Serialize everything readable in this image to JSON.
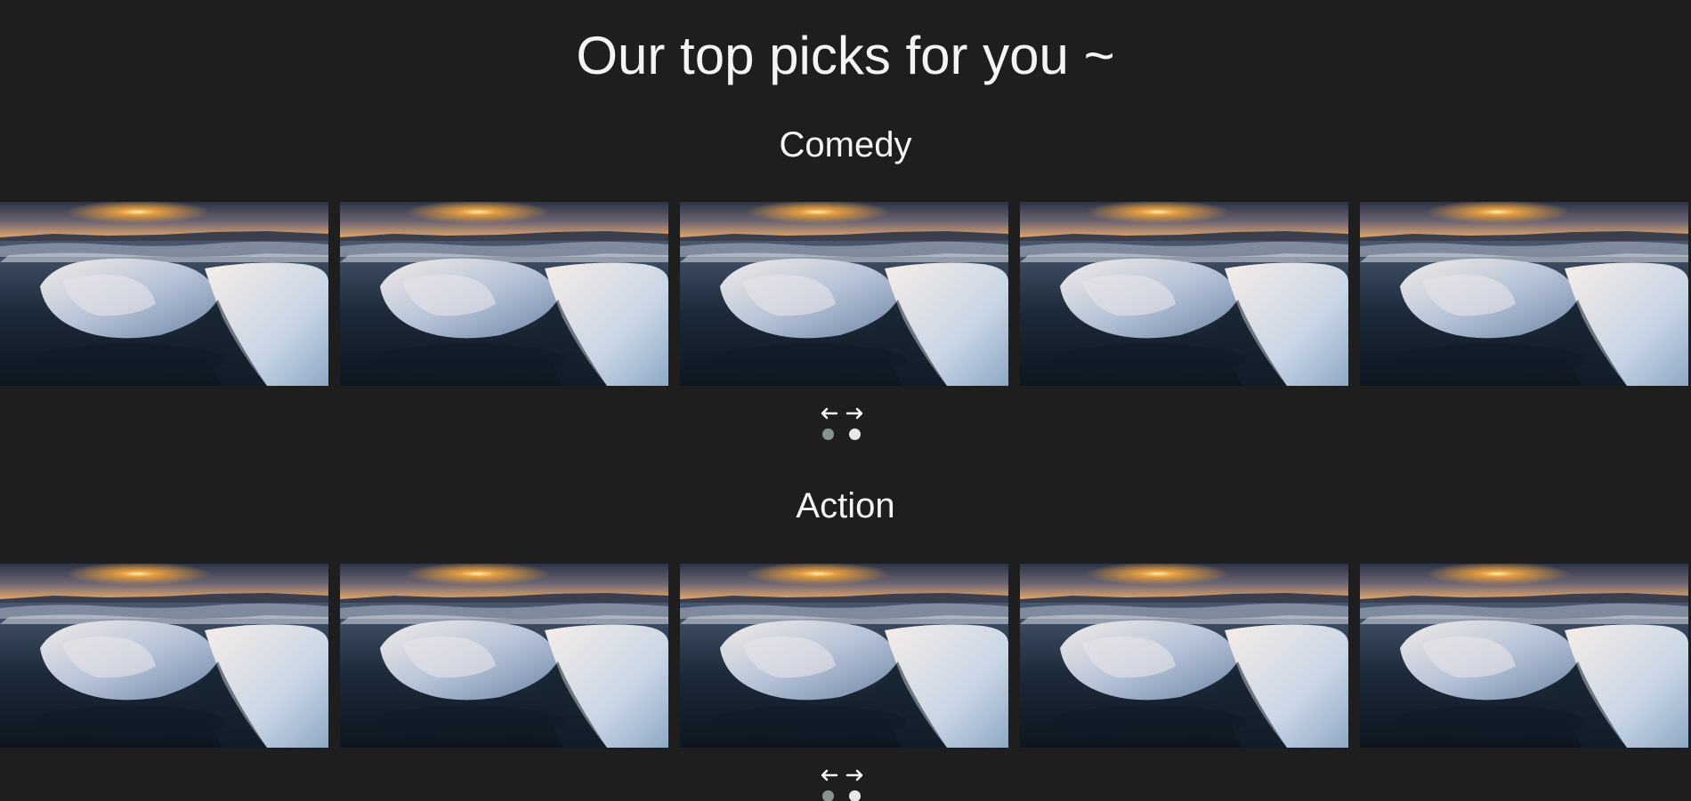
{
  "page": {
    "title": "Our top picks for you ~"
  },
  "sections": [
    {
      "title": "Comedy",
      "card_count": 5,
      "arrows": {
        "prev": "←",
        "next": "→"
      },
      "dots": 2,
      "active_dot": 0
    },
    {
      "title": "Action",
      "card_count": 5,
      "arrows": {
        "prev": "←",
        "next": "→"
      },
      "dots": 2,
      "active_dot": 0
    }
  ],
  "icons": {
    "card_image": "iceberg-sunset-image",
    "prev": "arrow-left-icon",
    "next": "arrow-right-icon"
  },
  "colors": {
    "background": "#1e1e1e",
    "text": "#f2f4f5",
    "dot_active": "#8a948f",
    "dot_inactive": "#e8e8e8"
  }
}
